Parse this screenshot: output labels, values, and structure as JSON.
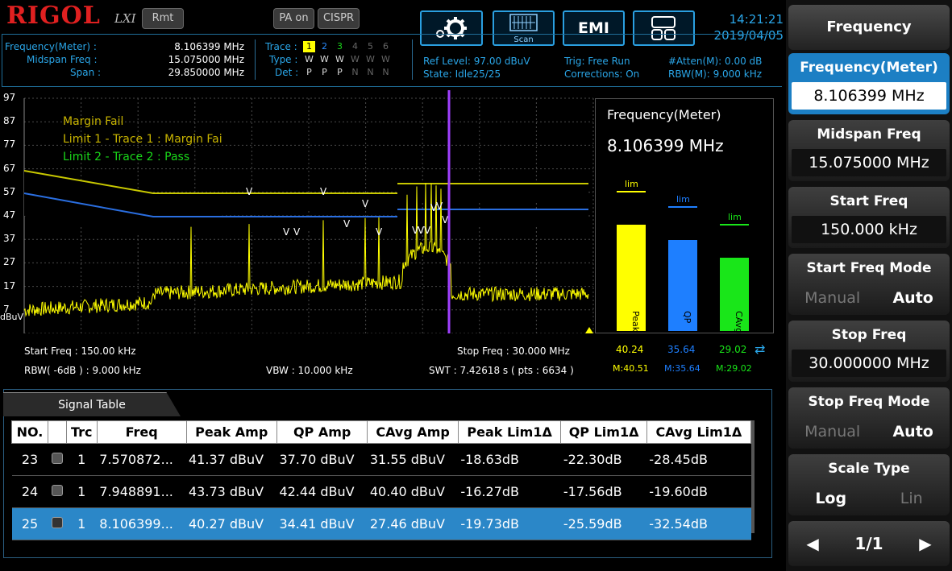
{
  "header": {
    "logo": "RIGOL",
    "lxi": "LXI",
    "rmt": "Rmt",
    "pa_on": "PA on",
    "cispr": "CISPR",
    "scan": "Scan",
    "emi": "EMI",
    "time": "14:21:21",
    "date": "2019/04/05"
  },
  "info": {
    "freq_meter_label": "Frequency(Meter) :",
    "freq_meter_value": "8.106399 MHz",
    "midspan_label": "Midspan Freq :",
    "midspan_value": "15.075000 MHz",
    "span_label": "Span :",
    "span_value": "29.850000 MHz",
    "trace_label": "Trace :",
    "trace_nums": [
      "1",
      "2",
      "3",
      "4",
      "5",
      "6"
    ],
    "type_label": "Type :",
    "type_vals": [
      "W",
      "W",
      "W",
      "W",
      "W",
      "W"
    ],
    "det_label": "Det :",
    "det_vals": [
      "P",
      "P",
      "P",
      "N",
      "N",
      "N"
    ],
    "ref_level": "Ref Level: 97.00 dBuV",
    "state": "State: Idle25/25",
    "trig": "Trig: Free Run",
    "corrections": "Corrections: On",
    "atten": "#Atten(M): 0.00 dB",
    "rbw_m": "RBW(M): 9.000 kHz"
  },
  "graph": {
    "y_ticks": [
      "97",
      "87",
      "77",
      "67",
      "57",
      "47",
      "37",
      "27",
      "17",
      "7"
    ],
    "y_unit": "dBuV",
    "annotations": [
      "Margin Fail",
      "Limit 1 - Trace 1 : Margin Fai",
      "Limit 2 - Trace 2 : Pass"
    ],
    "start_freq": "Start Freq : 150.00 kHz",
    "stop_freq": "Stop Freq : 30.000 MHz",
    "rbw": "RBW( -6dB ) : 9.000 kHz",
    "vbw": "VBW : 10.000 kHz",
    "swt": "SWT : 7.42618 s ( pts : 6634 )"
  },
  "meter": {
    "title": "Frequency(Meter)",
    "value": "8.106399 MHz",
    "bars": [
      {
        "name": "Peak",
        "value": "40.24",
        "max": "M:40.51",
        "lim": "lim",
        "color": "#ffff00",
        "level": 0.49
      },
      {
        "name": "QP",
        "value": "35.64",
        "max": "M:35.64",
        "lim": "lim",
        "color": "#1e7fff",
        "level": 0.42
      },
      {
        "name": "CAvg",
        "value": "29.02",
        "max": "M:29.02",
        "lim": "lim",
        "color": "#19e619",
        "level": 0.34
      }
    ]
  },
  "signal_table": {
    "title": "Signal Table",
    "headers": [
      "NO.",
      "",
      "Trc",
      "Freq",
      "Peak Amp",
      "QP Amp",
      "CAvg Amp",
      "Peak Lim1Δ",
      "QP Lim1Δ",
      "CAvg Lim1Δ"
    ],
    "rows": [
      {
        "no": "23",
        "trc": "1",
        "freq": "7.570872...",
        "peak": "41.37 dBuV",
        "qp": "37.70 dBuV",
        "cavg": "31.55 dBuV",
        "peak_lim": "-18.63dB",
        "qp_lim": "-22.30dB",
        "cavg_lim": "-28.45dB"
      },
      {
        "no": "24",
        "trc": "1",
        "freq": "7.948891...",
        "peak": "43.73 dBuV",
        "qp": "42.44 dBuV",
        "cavg": "40.40 dBuV",
        "peak_lim": "-16.27dB",
        "qp_lim": "-17.56dB",
        "cavg_lim": "-19.60dB"
      },
      {
        "no": "25",
        "trc": "1",
        "freq": "8.106399...",
        "peak": "40.27 dBuV",
        "qp": "34.41 dBuV",
        "cavg": "27.46 dBuV",
        "peak_lim": "-19.73dB",
        "qp_lim": "-25.59dB",
        "cavg_lim": "-32.54dB"
      }
    ]
  },
  "menu": {
    "title": "Frequency",
    "freq_meter": {
      "label": "Frequency(Meter)",
      "value": "8.106399 MHz"
    },
    "midspan": {
      "label": "Midspan Freq",
      "value": "15.075000 MHz"
    },
    "start": {
      "label": "Start Freq",
      "value": "150.000 kHz"
    },
    "start_mode": {
      "label": "Start Freq Mode",
      "off": "Manual",
      "on": "Auto"
    },
    "stop": {
      "label": "Stop Freq",
      "value": "30.000000 MHz"
    },
    "stop_mode": {
      "label": "Stop Freq Mode",
      "off": "Manual",
      "on": "Auto"
    },
    "scale": {
      "label": "Scale Type",
      "on": "Log",
      "off": "Lin"
    },
    "page": "1/1"
  }
}
